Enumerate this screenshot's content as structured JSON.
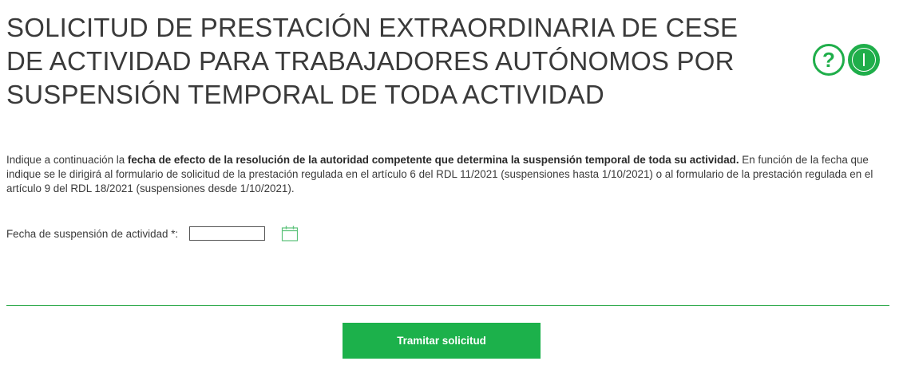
{
  "header": {
    "title_line1": "SOLICITUD DE PRESTACIÓN EXTRAORDINARIA DE CESE",
    "title_line2": "DE ACTIVIDAD PARA TRABAJADORES AUTÓNOMOS POR",
    "title_line3": "SUSPENSIÓN TEMPORAL DE TODA ACTIVIDAD",
    "help_glyph": "?",
    "icons": [
      "question-circle-icon",
      "info-circle-icon"
    ],
    "accent_color": "#1fae4a"
  },
  "intro": {
    "prefix": "Indique a continuación la ",
    "bold": "fecha de efecto de la resolución de la autoridad competente que determina la suspensión temporal de toda su actividad.",
    "suffix": " En función de la fecha que indique se le dirigirá al formulario de solicitud de la prestación regulada en el artículo 6 del RDL 11/2021 (suspensiones hasta 1/10/2021) o al formulario de la prestación regulada en el artículo 9 del RDL 18/2021 (suspensiones desde 1/10/2021)."
  },
  "form": {
    "date_label": "Fecha de suspensión de actividad *:",
    "date_value": "",
    "calendar_icon": "calendar-icon"
  },
  "actions": {
    "submit_label": "Tramitar solicitud",
    "button_color": "#1cb14b"
  }
}
